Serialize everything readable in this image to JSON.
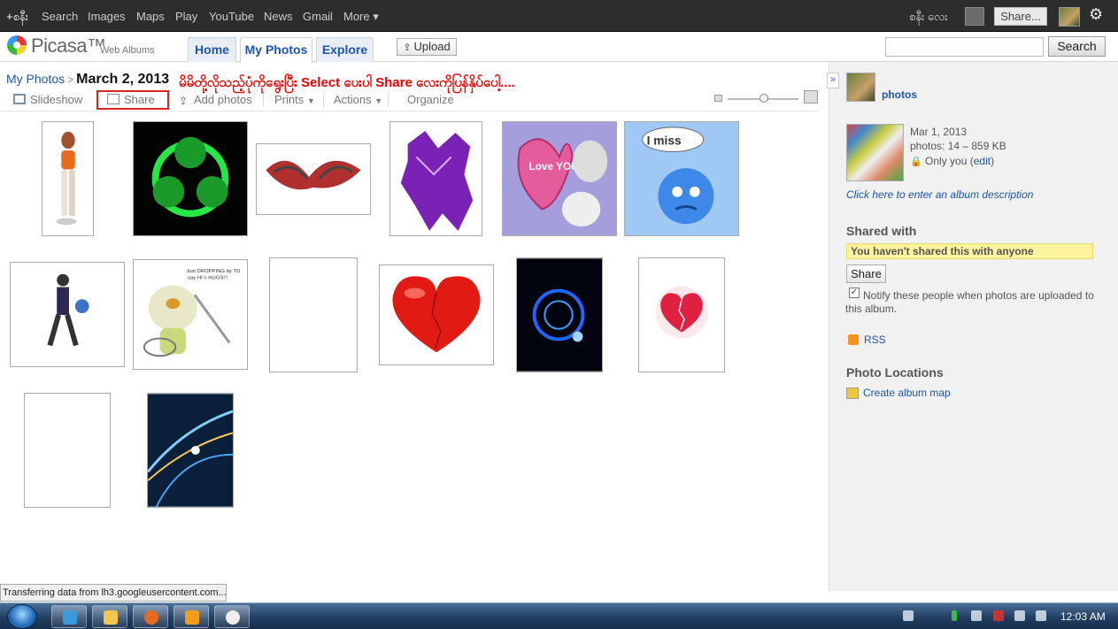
{
  "gbar": {
    "links": [
      "+စနီး",
      "Search",
      "Images",
      "Maps",
      "Play",
      "YouTube",
      "News",
      "Gmail",
      "More ▾"
    ],
    "username": "စနီး လေး",
    "share_label": "Share..."
  },
  "header": {
    "brand": "Picasa™",
    "brand_sub": "Web Albums",
    "tabs": [
      "Home",
      "My Photos",
      "Explore"
    ],
    "upload_label": "Upload",
    "search_placeholder": "",
    "search_button": "Search"
  },
  "breadcrumb": {
    "root": "My Photos",
    "separator": ">",
    "title": "March 2, 2013"
  },
  "note": "မိမိတို့လိုသည့်ပုံကိုရွေးပြီး Select ပေးပါ Share လေးကိုပြန်နှိပ်ပေါ့....",
  "toolbar": {
    "slideshow": "Slideshow",
    "share": "Share",
    "add_photos": "Add photos",
    "prints": "Prints",
    "actions": "Actions",
    "organize": "Organize"
  },
  "sidebar": {
    "user_link": "photos",
    "album_date": "Mar 1, 2013",
    "album_stats": "photos: 14 – 859 KB",
    "visibility": "Only you",
    "edit": "edit",
    "description_link": "Click here to enter an album description",
    "shared_with_heading": "Shared with",
    "shared_note": "You haven't shared this with anyone",
    "share_button": "Share",
    "notify_label": "Notify these people when photos are uploaded to this album.",
    "notify_checked": true,
    "rss": "RSS",
    "locations_heading": "Photo Locations",
    "create_map": "Create album map"
  },
  "status_text": "Transferring data from lh3.googleusercontent.com...",
  "clock": "12:03 AM",
  "colors": {
    "gbar_bg": "#2d2d2d",
    "link_blue": "#1e55a8",
    "annotation_red": "#e00000",
    "shared_note_bg": "#fff49e"
  }
}
